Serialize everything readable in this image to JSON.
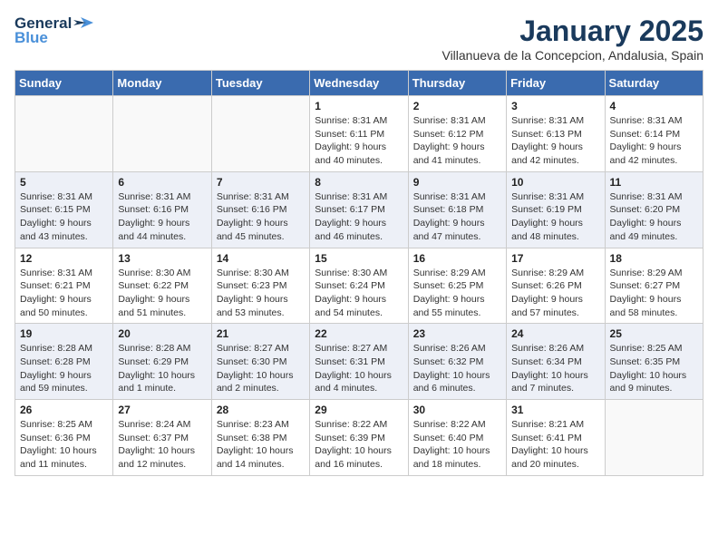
{
  "logo": {
    "line1": "General",
    "line2": "Blue"
  },
  "title": "January 2025",
  "subtitle": "Villanueva de la Concepcion, Andalusia, Spain",
  "days_of_week": [
    "Sunday",
    "Monday",
    "Tuesday",
    "Wednesday",
    "Thursday",
    "Friday",
    "Saturday"
  ],
  "weeks": [
    [
      {
        "day": "",
        "info": ""
      },
      {
        "day": "",
        "info": ""
      },
      {
        "day": "",
        "info": ""
      },
      {
        "day": "1",
        "info": "Sunrise: 8:31 AM\nSunset: 6:11 PM\nDaylight: 9 hours\nand 40 minutes."
      },
      {
        "day": "2",
        "info": "Sunrise: 8:31 AM\nSunset: 6:12 PM\nDaylight: 9 hours\nand 41 minutes."
      },
      {
        "day": "3",
        "info": "Sunrise: 8:31 AM\nSunset: 6:13 PM\nDaylight: 9 hours\nand 42 minutes."
      },
      {
        "day": "4",
        "info": "Sunrise: 8:31 AM\nSunset: 6:14 PM\nDaylight: 9 hours\nand 42 minutes."
      }
    ],
    [
      {
        "day": "5",
        "info": "Sunrise: 8:31 AM\nSunset: 6:15 PM\nDaylight: 9 hours\nand 43 minutes."
      },
      {
        "day": "6",
        "info": "Sunrise: 8:31 AM\nSunset: 6:16 PM\nDaylight: 9 hours\nand 44 minutes."
      },
      {
        "day": "7",
        "info": "Sunrise: 8:31 AM\nSunset: 6:16 PM\nDaylight: 9 hours\nand 45 minutes."
      },
      {
        "day": "8",
        "info": "Sunrise: 8:31 AM\nSunset: 6:17 PM\nDaylight: 9 hours\nand 46 minutes."
      },
      {
        "day": "9",
        "info": "Sunrise: 8:31 AM\nSunset: 6:18 PM\nDaylight: 9 hours\nand 47 minutes."
      },
      {
        "day": "10",
        "info": "Sunrise: 8:31 AM\nSunset: 6:19 PM\nDaylight: 9 hours\nand 48 minutes."
      },
      {
        "day": "11",
        "info": "Sunrise: 8:31 AM\nSunset: 6:20 PM\nDaylight: 9 hours\nand 49 minutes."
      }
    ],
    [
      {
        "day": "12",
        "info": "Sunrise: 8:31 AM\nSunset: 6:21 PM\nDaylight: 9 hours\nand 50 minutes."
      },
      {
        "day": "13",
        "info": "Sunrise: 8:30 AM\nSunset: 6:22 PM\nDaylight: 9 hours\nand 51 minutes."
      },
      {
        "day": "14",
        "info": "Sunrise: 8:30 AM\nSunset: 6:23 PM\nDaylight: 9 hours\nand 53 minutes."
      },
      {
        "day": "15",
        "info": "Sunrise: 8:30 AM\nSunset: 6:24 PM\nDaylight: 9 hours\nand 54 minutes."
      },
      {
        "day": "16",
        "info": "Sunrise: 8:29 AM\nSunset: 6:25 PM\nDaylight: 9 hours\nand 55 minutes."
      },
      {
        "day": "17",
        "info": "Sunrise: 8:29 AM\nSunset: 6:26 PM\nDaylight: 9 hours\nand 57 minutes."
      },
      {
        "day": "18",
        "info": "Sunrise: 8:29 AM\nSunset: 6:27 PM\nDaylight: 9 hours\nand 58 minutes."
      }
    ],
    [
      {
        "day": "19",
        "info": "Sunrise: 8:28 AM\nSunset: 6:28 PM\nDaylight: 9 hours\nand 59 minutes."
      },
      {
        "day": "20",
        "info": "Sunrise: 8:28 AM\nSunset: 6:29 PM\nDaylight: 10 hours\nand 1 minute."
      },
      {
        "day": "21",
        "info": "Sunrise: 8:27 AM\nSunset: 6:30 PM\nDaylight: 10 hours\nand 2 minutes."
      },
      {
        "day": "22",
        "info": "Sunrise: 8:27 AM\nSunset: 6:31 PM\nDaylight: 10 hours\nand 4 minutes."
      },
      {
        "day": "23",
        "info": "Sunrise: 8:26 AM\nSunset: 6:32 PM\nDaylight: 10 hours\nand 6 minutes."
      },
      {
        "day": "24",
        "info": "Sunrise: 8:26 AM\nSunset: 6:34 PM\nDaylight: 10 hours\nand 7 minutes."
      },
      {
        "day": "25",
        "info": "Sunrise: 8:25 AM\nSunset: 6:35 PM\nDaylight: 10 hours\nand 9 minutes."
      }
    ],
    [
      {
        "day": "26",
        "info": "Sunrise: 8:25 AM\nSunset: 6:36 PM\nDaylight: 10 hours\nand 11 minutes."
      },
      {
        "day": "27",
        "info": "Sunrise: 8:24 AM\nSunset: 6:37 PM\nDaylight: 10 hours\nand 12 minutes."
      },
      {
        "day": "28",
        "info": "Sunrise: 8:23 AM\nSunset: 6:38 PM\nDaylight: 10 hours\nand 14 minutes."
      },
      {
        "day": "29",
        "info": "Sunrise: 8:22 AM\nSunset: 6:39 PM\nDaylight: 10 hours\nand 16 minutes."
      },
      {
        "day": "30",
        "info": "Sunrise: 8:22 AM\nSunset: 6:40 PM\nDaylight: 10 hours\nand 18 minutes."
      },
      {
        "day": "31",
        "info": "Sunrise: 8:21 AM\nSunset: 6:41 PM\nDaylight: 10 hours\nand 20 minutes."
      },
      {
        "day": "",
        "info": ""
      }
    ]
  ]
}
